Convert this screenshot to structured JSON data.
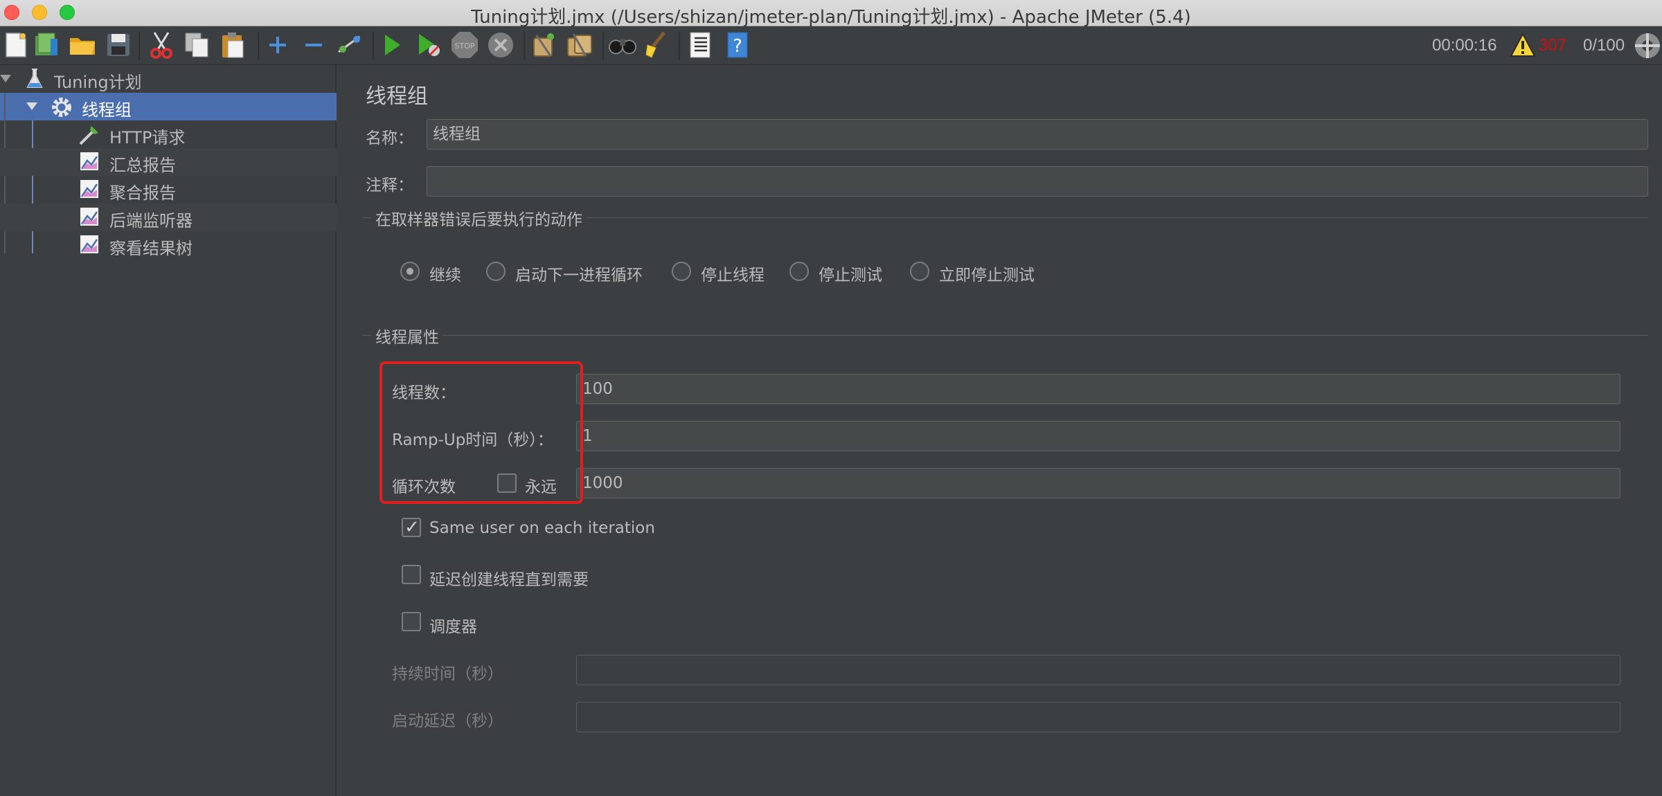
{
  "window": {
    "title": "Tuning计划.jmx (/Users/shizan/jmeter-plan/Tuning计划.jmx) - Apache JMeter (5.4)"
  },
  "toolbar": {
    "icons": [
      "new-icon",
      "templates-icon",
      "open-icon",
      "save-icon",
      "cut-icon",
      "copy-icon",
      "paste-icon",
      "expand-icon",
      "collapse-icon",
      "toggle-icon",
      "start-icon",
      "start-no-pause-icon",
      "stop-icon",
      "shutdown-icon",
      "clear-icon",
      "clear-all-icon",
      "search-icon",
      "reset-search-icon",
      "function-helper-icon",
      "help-icon"
    ],
    "timer": "00:00:16",
    "warning_count": "307",
    "threads_ratio": "0/100"
  },
  "tree": {
    "items": [
      {
        "label": "Tuning计划"
      },
      {
        "label": "线程组"
      },
      {
        "label": "HTTP请求"
      },
      {
        "label": "汇总报告"
      },
      {
        "label": "聚合报告"
      },
      {
        "label": "后端监听器"
      },
      {
        "label": "察看结果树"
      }
    ]
  },
  "panel": {
    "title": "线程组",
    "name_label": "名称：",
    "name_value": "线程组",
    "comment_label": "注释：",
    "comment_value": "",
    "error_section_title": "在取样器错误后要执行的动作",
    "error_actions": [
      {
        "label": "继续",
        "checked": true
      },
      {
        "label": "启动下一进程循环",
        "checked": false
      },
      {
        "label": "停止线程",
        "checked": false
      },
      {
        "label": "停止测试",
        "checked": false
      },
      {
        "label": "立即停止测试",
        "checked": false
      }
    ],
    "thread_section_title": "线程属性",
    "threads_label": "线程数：",
    "threads_value": "100",
    "rampup_label": "Ramp-Up时间（秒）：",
    "rampup_value": "1",
    "loop_label": "循环次数",
    "forever_label": "永远",
    "forever_checked": false,
    "loop_value": "1000",
    "same_user_label": "Same user on each iteration",
    "same_user_checked": true,
    "delay_create_label": "延迟创建线程直到需要",
    "delay_create_checked": false,
    "scheduler_label": "调度器",
    "scheduler_checked": false,
    "duration_label": "持续时间（秒）",
    "duration_value": "",
    "startup_delay_label": "启动延迟（秒）",
    "startup_delay_value": ""
  },
  "colors": {
    "background": "#3c3f41",
    "selection": "#4b6eaf",
    "highlight": "#e02020",
    "warning_text": "#d01010"
  }
}
